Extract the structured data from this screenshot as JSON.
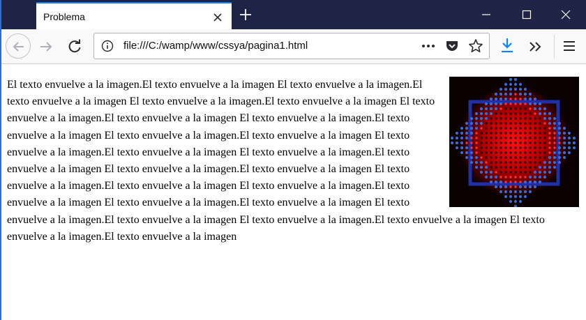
{
  "window": {
    "tab_title": "Problema",
    "new_tab_icon": "plus-icon",
    "controls": [
      "minimize-icon",
      "maximize-icon",
      "close-icon"
    ]
  },
  "toolbar": {
    "icons": [
      "back-arrow-icon",
      "forward-arrow-icon",
      "reload-icon",
      "download-icon",
      "overflow-chevron-icon",
      "hamburger-menu-icon"
    ]
  },
  "urlbar": {
    "url": "file:///C:/wamp/www/cssya/pagina1.html",
    "icons": [
      "info-icon",
      "page-actions-icon",
      "pocket-icon",
      "bookmark-star-icon"
    ]
  },
  "page": {
    "text": "El texto envuelve a la imagen.El texto envuelve a la imagen El texto envuelve a la imagen.El texto envuelve a la imagen El texto envuelve a la imagen.El texto envuelve a la imagen El texto envuelve a la imagen.El texto envuelve a la imagen El texto envuelve a la imagen.El texto envuelve a la imagen El texto envuelve a la imagen.El texto envuelve a la imagen El texto envuelve a la imagen.El texto envuelve a la imagen El texto envuelve a la imagen.El texto envuelve a la imagen El texto envuelve a la imagen.El texto envuelve a la imagen El texto envuelve a la imagen.El texto envuelve a la imagen El texto envuelve a la imagen.El texto envuelve a la imagen El texto envuelve a la imagen.El texto envuelve a la imagen El texto envuelve a la imagen.El texto envuelve a la imagen El texto envuelve a la imagen.El texto envuelve a la imagen El texto envuelve a la imagen.El texto envuelve a la imagen",
    "image_colors": {
      "background": "#0a0000",
      "center": "#ff1010",
      "ring": "#1f2fa8",
      "dots": "#3a6ad8"
    }
  }
}
